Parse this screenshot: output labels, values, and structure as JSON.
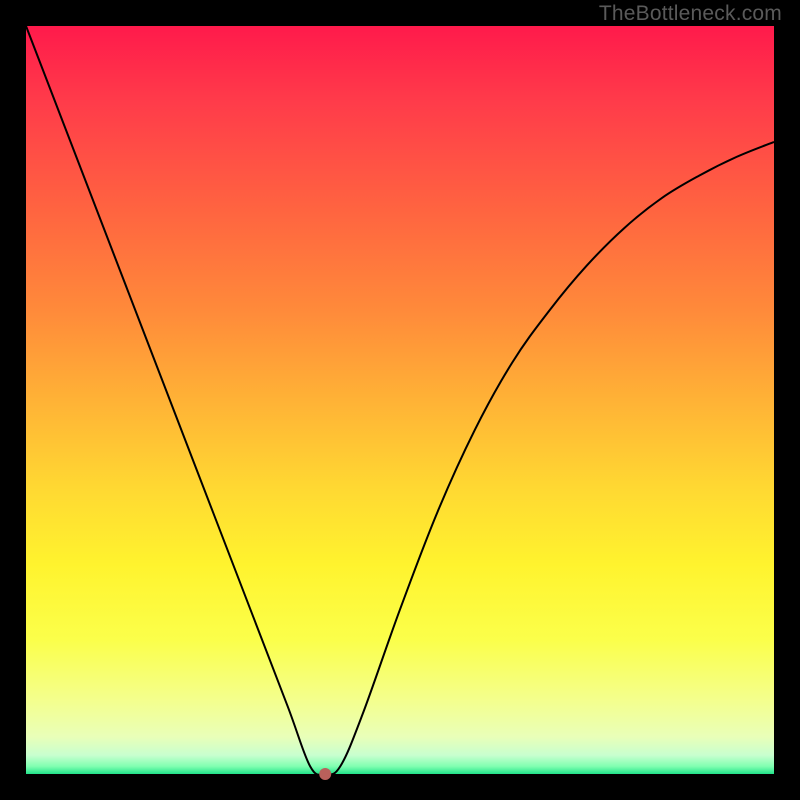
{
  "watermark": "TheBottleneck.com",
  "chart_data": {
    "type": "line",
    "title": "",
    "xlabel": "",
    "ylabel": "",
    "xlim": [
      0,
      100
    ],
    "ylim": [
      0,
      100
    ],
    "grid": false,
    "series": [
      {
        "name": "curve",
        "x": [
          0,
          5,
          10,
          15,
          20,
          25,
          30,
          35,
          38,
          40,
          42,
          45,
          50,
          55,
          60,
          65,
          70,
          75,
          80,
          85,
          90,
          95,
          100
        ],
        "values": [
          100,
          87,
          74,
          61,
          48,
          35,
          22,
          9,
          1,
          0,
          1,
          8,
          22,
          35,
          46,
          55,
          62,
          68,
          73,
          77,
          80,
          82.5,
          84.5
        ]
      }
    ],
    "marker": {
      "x": 40,
      "y": 0,
      "color": "#b9605b",
      "radius": 6
    }
  }
}
